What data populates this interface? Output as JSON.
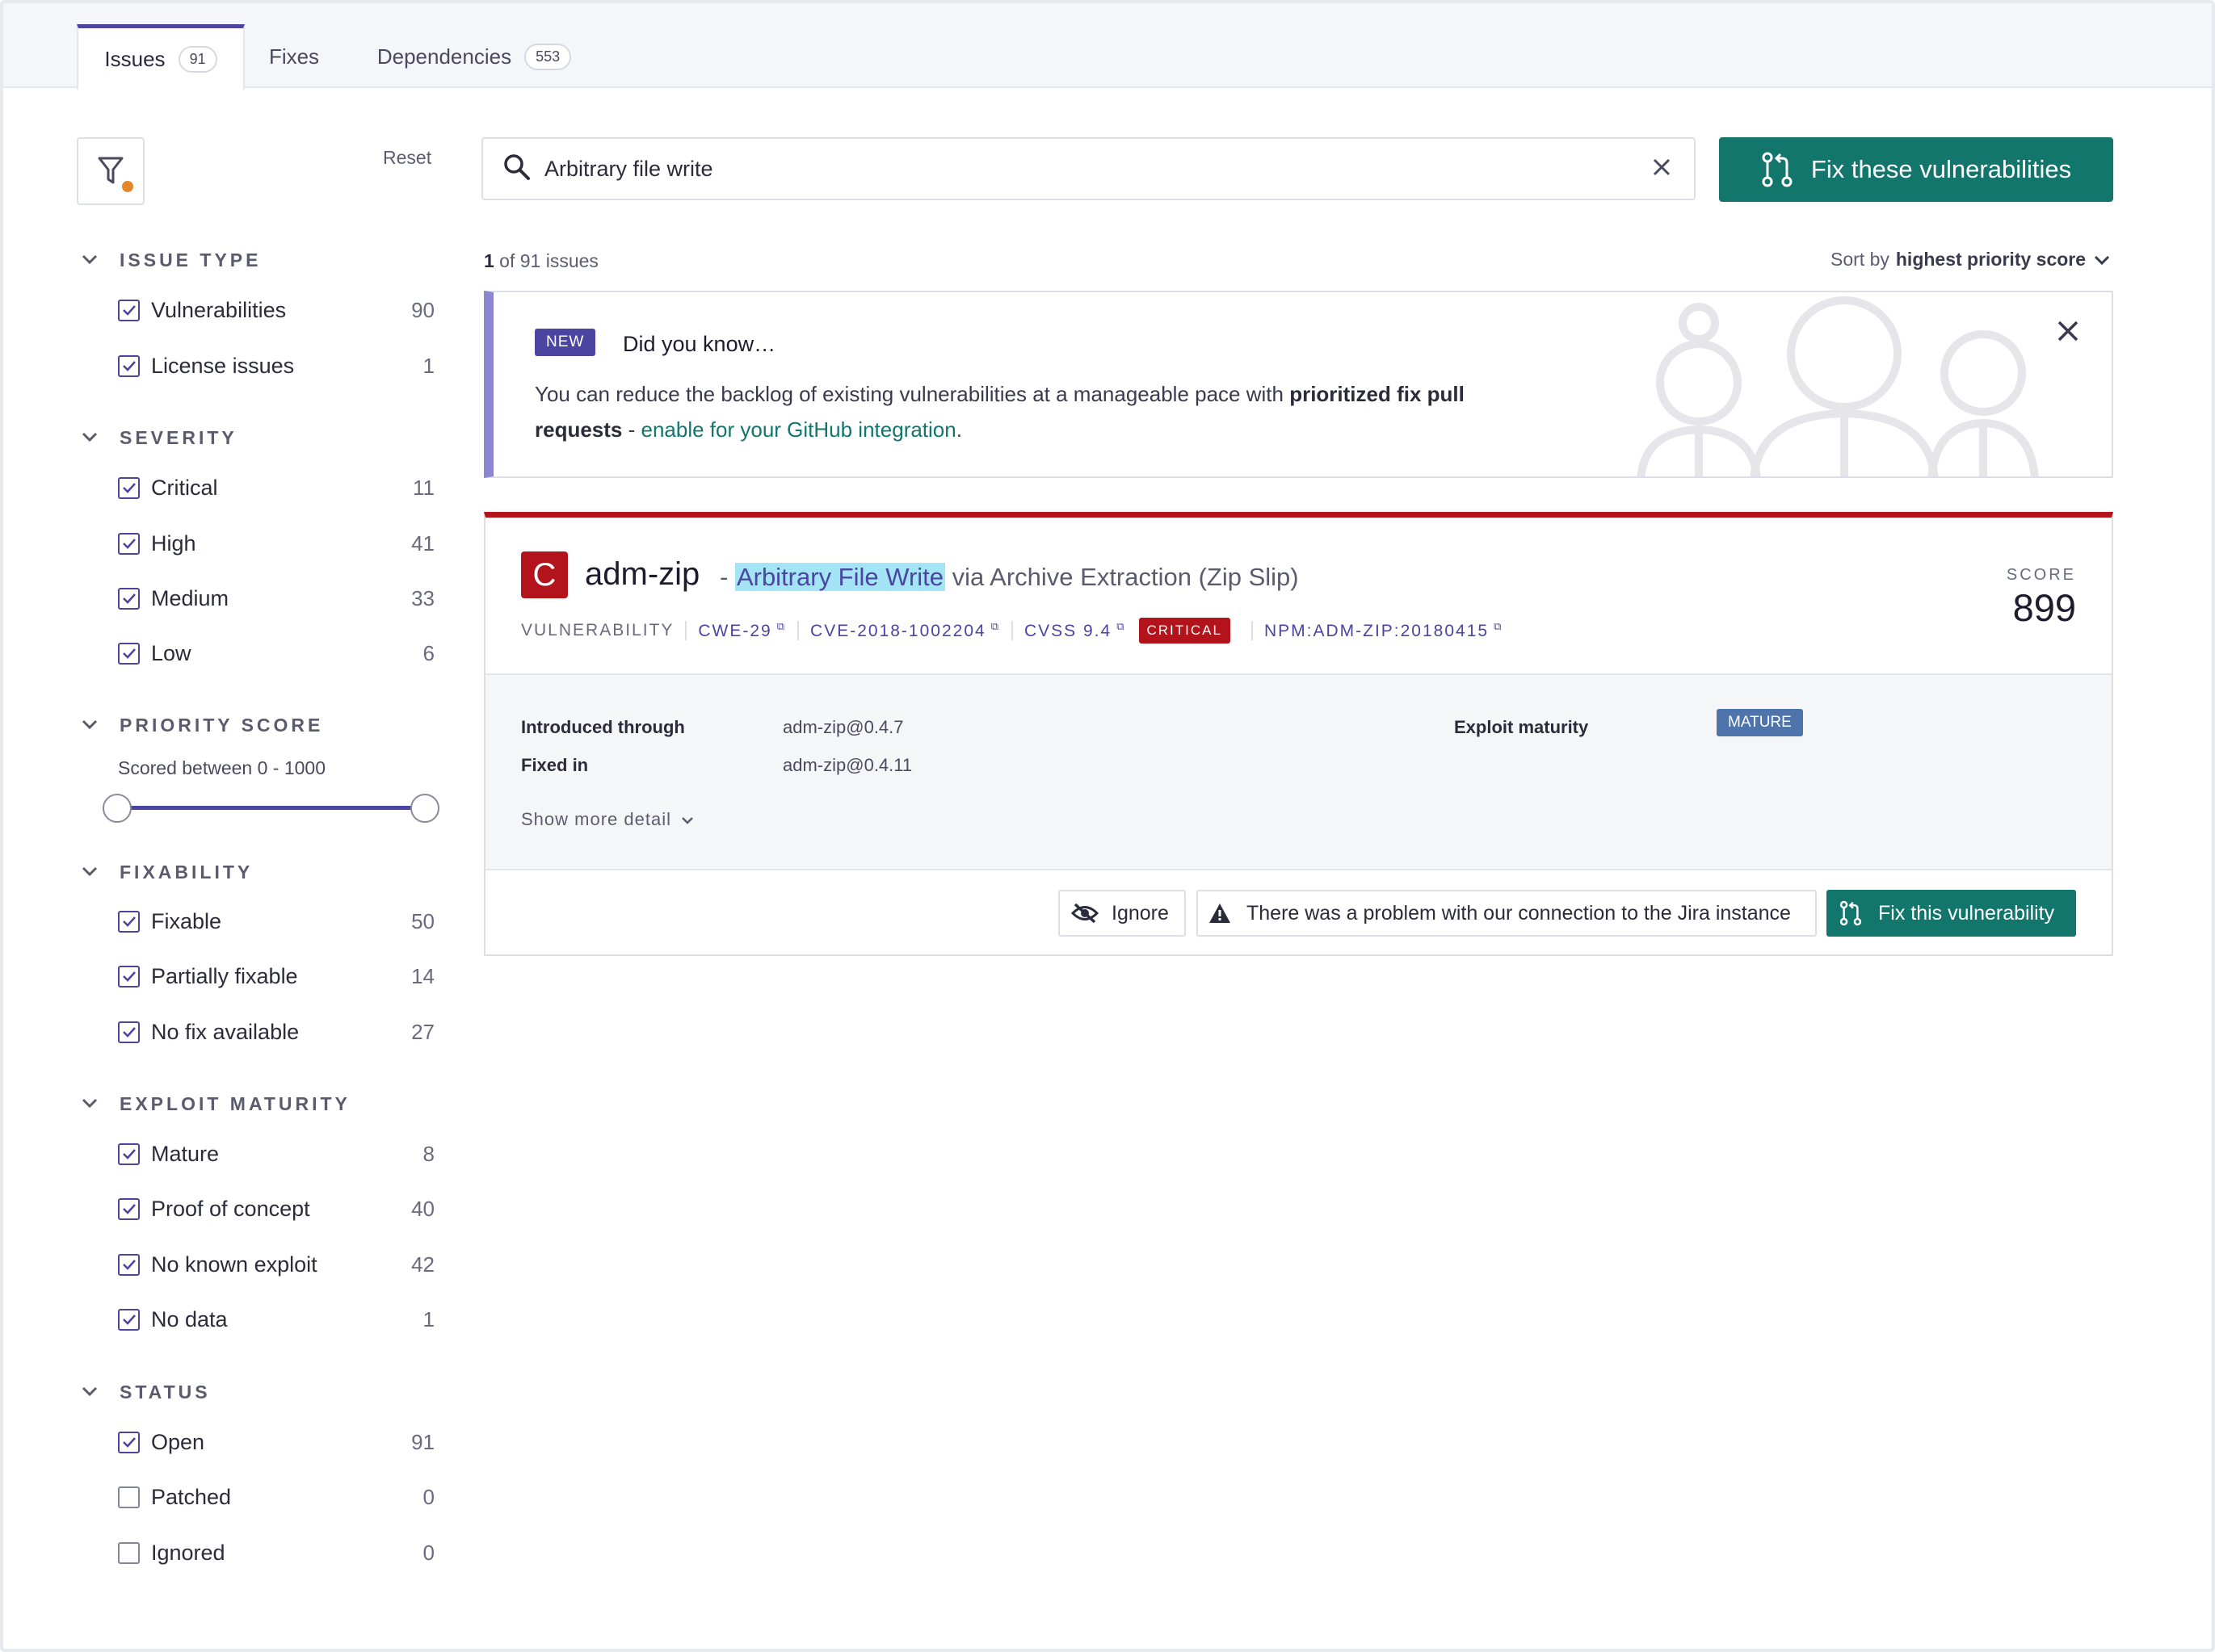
{
  "tabs": [
    {
      "label": "Issues",
      "count": "91"
    },
    {
      "label": "Fixes"
    },
    {
      "label": "Dependencies",
      "count": "553"
    }
  ],
  "sidebar": {
    "reset_label": "Reset",
    "sections": {
      "issue_type": {
        "title": "ISSUE TYPE",
        "items": [
          {
            "label": "Vulnerabilities",
            "count": "90",
            "checked": true
          },
          {
            "label": "License issues",
            "count": "1",
            "checked": true
          }
        ]
      },
      "severity": {
        "title": "SEVERITY",
        "items": [
          {
            "label": "Critical",
            "count": "11",
            "checked": true
          },
          {
            "label": "High",
            "count": "41",
            "checked": true
          },
          {
            "label": "Medium",
            "count": "33",
            "checked": true
          },
          {
            "label": "Low",
            "count": "6",
            "checked": true
          }
        ]
      },
      "priority_score": {
        "title": "PRIORITY SCORE",
        "range_label": "Scored between 0 - 1000",
        "min": 0,
        "max": 1000
      },
      "fixability": {
        "title": "FIXABILITY",
        "items": [
          {
            "label": "Fixable",
            "count": "50",
            "checked": true
          },
          {
            "label": "Partially fixable",
            "count": "14",
            "checked": true
          },
          {
            "label": "No fix available",
            "count": "27",
            "checked": true
          }
        ]
      },
      "exploit_maturity": {
        "title": "EXPLOIT MATURITY",
        "items": [
          {
            "label": "Mature",
            "count": "8",
            "checked": true
          },
          {
            "label": "Proof of concept",
            "count": "40",
            "checked": true
          },
          {
            "label": "No known exploit",
            "count": "42",
            "checked": true
          },
          {
            "label": "No data",
            "count": "1",
            "checked": true
          }
        ]
      },
      "status": {
        "title": "STATUS",
        "items": [
          {
            "label": "Open",
            "count": "91",
            "checked": true
          },
          {
            "label": "Patched",
            "count": "0",
            "checked": false
          },
          {
            "label": "Ignored",
            "count": "0",
            "checked": false
          }
        ]
      }
    }
  },
  "search": {
    "value": "Arbitrary file write"
  },
  "fix_all_button": "Fix these vulnerabilities",
  "results": {
    "shown": "1",
    "suffix": " of 91 issues"
  },
  "sort": {
    "prefix": "Sort by",
    "value": "highest priority score"
  },
  "banner": {
    "badge": "NEW",
    "title": "Did you know…",
    "text_before": "You can reduce the backlog of existing vulnerabilities at a manageable pace with ",
    "text_bold": "prioritized fix pull requests",
    "text_dash": " - ",
    "link": "enable for your GitHub integration",
    "text_after": "."
  },
  "issue": {
    "severity_letter": "C",
    "package": "adm-zip",
    "dash": " - ",
    "highlight": "Arbitrary File Write",
    "title_rest": " via Archive Extraction (Zip Slip)",
    "type": "VULNERABILITY",
    "cwe": "CWE-29",
    "cve": "CVE-2018-1002204",
    "cvss": "CVSS 9.4",
    "severity_badge": "CRITICAL",
    "snyk_id": "NPM:ADM-ZIP:20180415",
    "score_label": "SCORE",
    "score": "899",
    "details": {
      "introduced_label": "Introduced through",
      "introduced_value": "adm-zip@0.4.7",
      "fixed_label": "Fixed in",
      "fixed_value": "adm-zip@0.4.11",
      "exploit_label": "Exploit maturity",
      "exploit_value": "MATURE",
      "show_more": "Show more detail"
    },
    "actions": {
      "ignore": "Ignore",
      "jira_warning": "There was a problem with our connection to the Jira instance",
      "fix": "Fix this vulnerability"
    }
  },
  "colors": {
    "accent": "#4b45a1",
    "primary_green": "#12766d",
    "critical_red": "#b3141c",
    "banner_stripe": "#8c86d1",
    "mature_blue": "#4e74ab",
    "dot_orange": "#e4862a"
  },
  "icons": [
    "filter-icon",
    "search-icon",
    "close-icon",
    "pull-request-icon",
    "chevron-down-icon",
    "eye-off-icon",
    "warning-icon",
    "external-link-icon",
    "checkbox-check-icon"
  ]
}
